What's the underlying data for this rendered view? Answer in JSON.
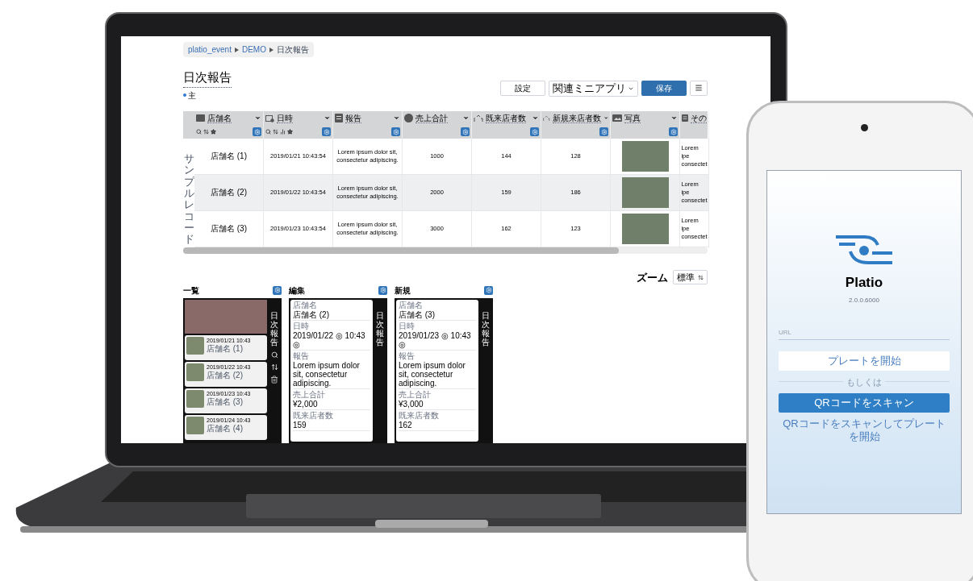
{
  "breadcrumb": [
    "platio_event",
    "DEMO",
    "日次報告"
  ],
  "title": "日次報告",
  "legend": {
    "label": "主",
    "color": "#2f7bd0"
  },
  "toolbar": {
    "settings": "設定",
    "related": "関連ミニアプリ",
    "save": "保存"
  },
  "table": {
    "columns": [
      {
        "label": "店舗名",
        "kind": "text"
      },
      {
        "label": "日時",
        "kind": "datetime"
      },
      {
        "label": "報告",
        "kind": "note"
      },
      {
        "label": "売上合計",
        "kind": "money"
      },
      {
        "label": "既来店者数",
        "kind": "number"
      },
      {
        "label": "新規来店者数",
        "kind": "number"
      },
      {
        "label": "写真",
        "kind": "image"
      },
      {
        "label": "その",
        "kind": "note"
      }
    ],
    "side_label": "サンプルレコード",
    "rows": [
      [
        "店舗名 (1)",
        "2019/01/21 10:43:54",
        "Lorem ipsum dolor sit, consectetur adipiscing.",
        "1000",
        "144",
        "128",
        "",
        "Lorem ipe consectet"
      ],
      [
        "店舗名 (2)",
        "2019/01/22 10:43:54",
        "Lorem ipsum dolor sit, consectetur adipiscing.",
        "2000",
        "159",
        "186",
        "",
        "Lorem ipe consectet"
      ],
      [
        "店舗名 (3)",
        "2019/01/23 10:43:54",
        "Lorem ipsum dolor sit, consectetur adipiscing.",
        "3000",
        "162",
        "123",
        "",
        "Lorem ipe consectet"
      ]
    ]
  },
  "zoom": {
    "label": "ズーム",
    "value": "標準"
  },
  "previews": [
    {
      "title": "一覧",
      "kind": "list",
      "side_title": "日次報告",
      "items": [
        {
          "date": "2019/01/21 10:43",
          "name": "店舗名 (1)"
        },
        {
          "date": "2019/01/22 10:43",
          "name": "店舗名 (2)"
        },
        {
          "date": "2019/01/23 10:43",
          "name": "店舗名 (3)"
        },
        {
          "date": "2019/01/24 10:43",
          "name": "店舗名 (4)"
        }
      ]
    },
    {
      "title": "編集",
      "kind": "form",
      "side_title": "日次報告",
      "fields": [
        {
          "label": "店舗名",
          "value": "店舗名 (2)"
        },
        {
          "label": "日時",
          "value": "2019/01/22 ◎ 10:43 ◎"
        },
        {
          "label": "報告",
          "value": "Lorem ipsum dolor sit, consectetur adipiscing."
        },
        {
          "label": "売上合計",
          "value": "¥2,000"
        },
        {
          "label": "既来店者数",
          "value": "159"
        }
      ]
    },
    {
      "title": "新規",
      "kind": "form",
      "side_title": "日次報告",
      "fields": [
        {
          "label": "店舗名",
          "value": "店舗名 (3)"
        },
        {
          "label": "日時",
          "value": "2019/01/23 ◎ 10:43 ◎"
        },
        {
          "label": "報告",
          "value": "Lorem ipsum dolor sit, consectetur adipiscing."
        },
        {
          "label": "売上合計",
          "value": "¥3,000"
        },
        {
          "label": "既来店者数",
          "value": "162"
        }
      ]
    }
  ],
  "phone": {
    "app_name": "Platio",
    "version": "2.0.0.6000",
    "url_placeholder": "URL",
    "open_button": "プレートを開始",
    "separator": "もしくは",
    "scan_button": "QRコードをスキャン",
    "hint": "QRコードをスキャンしてプレートを開始"
  }
}
